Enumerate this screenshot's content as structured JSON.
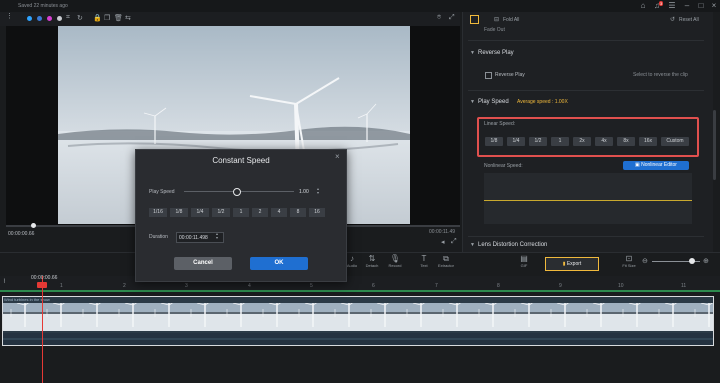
{
  "app": {
    "saved": "Saved 22 minutes ago"
  },
  "window": {
    "notif_count": "3"
  },
  "preview": {
    "time_current": "00:00:00.66",
    "time_total": "00:00:11.49"
  },
  "panel": {
    "fold_all": "Fold All",
    "reset_all": "Reset All",
    "fade_out": "Fade Out",
    "reverse_play_header": "Reverse Play",
    "reverse_play_label": "Reverse Play",
    "reverse_hint": "Select to reverse the clip",
    "play_speed_header": "Play Speed",
    "average_speed": "Average speed : 1.00X",
    "linear_speed": "Linear Speed:",
    "linear_options": [
      "1/8",
      "1/4",
      "1/2",
      "1",
      "2x",
      "4x",
      "8x",
      "16x",
      "Custom"
    ],
    "nonlinear_speed": "Nonlinear Speed:",
    "nonlinear_editor": "Nonlinear Editor",
    "lens_distortion": "Lens Distortion Correction"
  },
  "toolbar": {
    "detach": "Detach",
    "record": "Record",
    "text": "Text",
    "extractor": "Extractor",
    "gif": "GIF",
    "export": "Export",
    "fit_size": "Fit Size",
    "audio": "Audio"
  },
  "ruler": {
    "playhead_time": "00:00:00.66",
    "ticks": [
      "1",
      "2",
      "3",
      "4",
      "5",
      "6",
      "7",
      "8",
      "9",
      "10",
      "11"
    ]
  },
  "track": {
    "name": "Wind turbines in the snow"
  },
  "dialog": {
    "title": "Constant Speed",
    "play_speed_label": "Play Speed",
    "play_speed_value": "1.00",
    "speed_options": [
      "1/16",
      "1/8",
      "1/4",
      "1/2",
      "1",
      "2",
      "4",
      "8",
      "16"
    ],
    "duration_label": "Duration",
    "duration_value": "00:00:11.498",
    "cancel": "Cancel",
    "ok": "OK"
  },
  "colors": {
    "accent_blue": "#1f6fd1",
    "highlight_red": "#e0504e",
    "export_border": "#f0b93c",
    "timeline_green": "#2d8a4e"
  }
}
